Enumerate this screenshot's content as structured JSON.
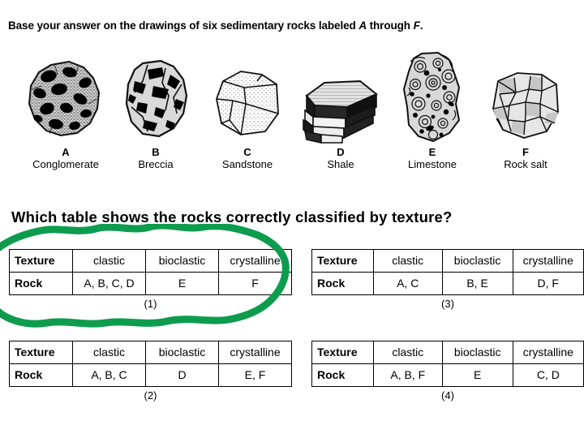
{
  "heading": {
    "text_before": "Base your answer on the drawings of six sedimentary rocks labeled ",
    "letter_first": "A",
    "text_middle": " through ",
    "letter_last": "F",
    "text_after": "."
  },
  "question": {
    "text": "Which table shows the rocks correctly classified by texture?"
  },
  "figure": {
    "rocks": [
      {
        "letter": "A",
        "name": "Conglomerate",
        "icon": "conglomerate-rock-icon"
      },
      {
        "letter": "B",
        "name": "Breccia",
        "icon": "breccia-rock-icon"
      },
      {
        "letter": "C",
        "name": "Sandstone",
        "icon": "sandstone-rock-icon"
      },
      {
        "letter": "D",
        "name": "Shale",
        "icon": "shale-rock-icon"
      },
      {
        "letter": "E",
        "name": "Limestone",
        "icon": "limestone-rock-icon"
      },
      {
        "letter": "F",
        "name": "Rock salt",
        "icon": "rock-salt-icon"
      }
    ]
  },
  "answers": {
    "row_labels": {
      "texture": "Texture",
      "rock": "Rock"
    },
    "options": [
      {
        "caption": "(1)",
        "textures": [
          "clastic",
          "bioclastic",
          "crystalline"
        ],
        "rocks": [
          "A, B, C, D",
          "E",
          "F"
        ],
        "selected": true
      },
      {
        "caption": "(3)",
        "textures": [
          "clastic",
          "bioclastic",
          "crystalline"
        ],
        "rocks": [
          "A, C",
          "B, E",
          "D, F"
        ],
        "selected": false
      },
      {
        "caption": "(2)",
        "textures": [
          "clastic",
          "bioclastic",
          "crystalline"
        ],
        "rocks": [
          "A, B, C",
          "D",
          "E, F"
        ],
        "selected": false
      },
      {
        "caption": "(4)",
        "textures": [
          "clastic",
          "bioclastic",
          "crystalline"
        ],
        "rocks": [
          "A, B, F",
          "E",
          "C, D"
        ],
        "selected": false
      }
    ]
  },
  "annotation": {
    "type": "hand-drawn-circle",
    "target_caption": "(1)",
    "color": "#0d9c4e"
  }
}
